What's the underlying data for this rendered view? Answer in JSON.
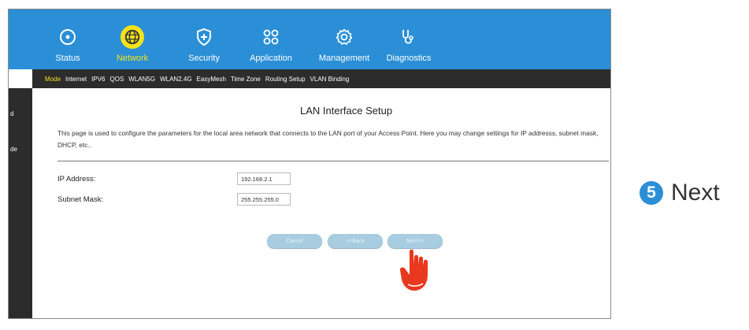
{
  "nav": {
    "top_items": [
      {
        "label": "Status",
        "icon": "crosshair-icon"
      },
      {
        "label": "Network",
        "icon": "globe-icon"
      },
      {
        "label": "Security",
        "icon": "shield-plus-icon"
      },
      {
        "label": "Application",
        "icon": "apps-grid-icon"
      },
      {
        "label": "Management",
        "icon": "gear-icon"
      },
      {
        "label": "Diagnostics",
        "icon": "stethoscope-icon"
      }
    ],
    "sub_items": [
      "Mode",
      "Internet",
      "IPV6",
      "QOS",
      "WLAN5G",
      "WLAN2.4G",
      "EasyMesh",
      "Time Zone",
      "Routing Setup",
      "VLAN Binding"
    ],
    "side_items": [
      "d",
      "de"
    ]
  },
  "page": {
    "title": "LAN Interface Setup",
    "description": "This page is used to configure the parameters for the local area network that connects to the LAN port of your Access Point. Here you may change settings for IP addresss, subnet mask, DHCP, etc..",
    "fields": {
      "ip_label": "IP Address:",
      "ip_value": "192.168.2.1",
      "mask_label": "Subnet Mask:",
      "mask_value": "255.255.255.0"
    },
    "buttons": {
      "cancel": "Cancel",
      "back": "<<Back",
      "next": "Next>>"
    }
  },
  "step": {
    "number": "5",
    "label": "Next"
  },
  "colors": {
    "topbar": "#2a8fd6",
    "active": "#f4e21a",
    "subbar": "#2c2c2c",
    "button": "#a8cde1",
    "hand": "#e8381e"
  }
}
